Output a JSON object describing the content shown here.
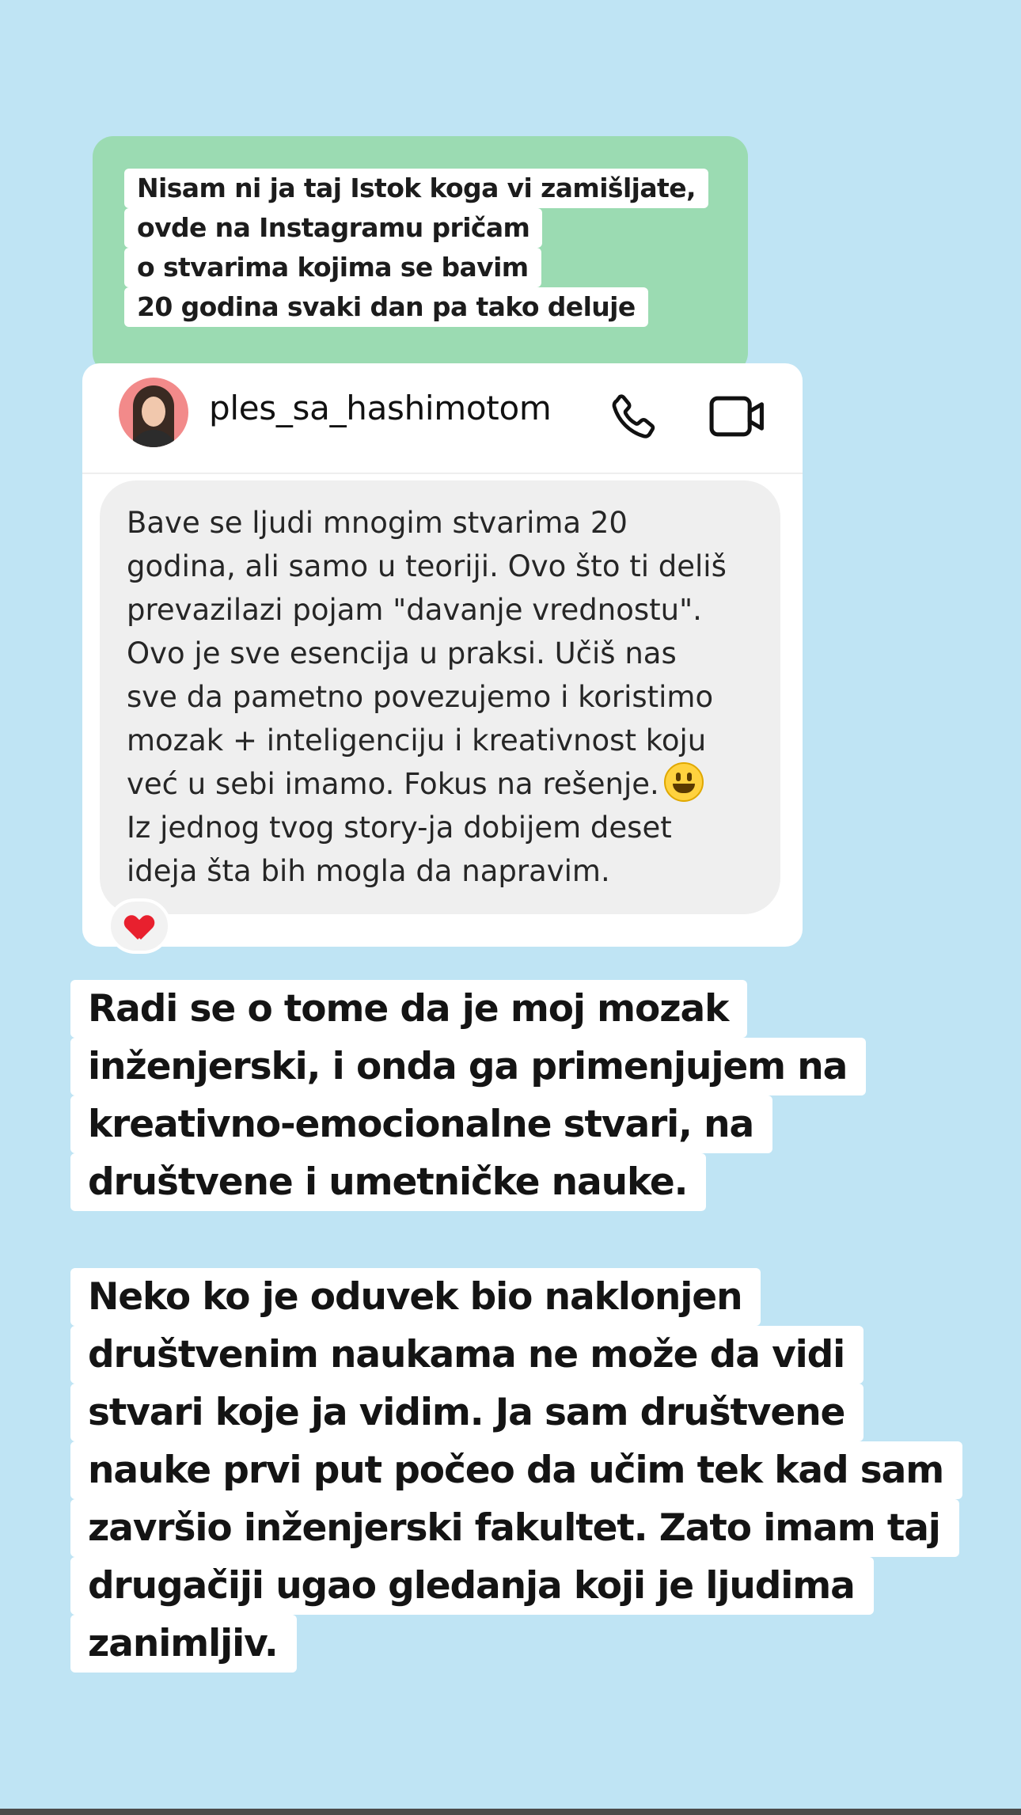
{
  "top_caption": {
    "lines": [
      "Nisam ni ja taj Istok koga vi zamišljate,",
      "ovde na Instagramu pričam",
      "o stvarima kojima se bavim",
      "20 godina svaki dan pa tako deluje"
    ]
  },
  "dm": {
    "username": "ples_sa_hashimotom",
    "icons": {
      "avatar": "profile-avatar",
      "call": "phone-icon",
      "video": "video-camera-icon"
    },
    "message": {
      "text_before_emoji": "Bave se ljudi mnogim stvarima 20\ngodina, ali samo u teoriji. Ovo što ti deliš\nprevazilazi pojam \"davanje vrednostu\".\nOvo je sve esencija u praksi. Učiš nas\nsve da pametno povezujemo i koristimo\nmozak + inteligenciju i kreativnost koju\nveć u sebi imamo. Fokus na rešenje.",
      "emoji": "smiley-emoji",
      "text_after_emoji": "Iz jednog tvog story-ja dobijem deset\nideja šta bih mogla da napravim."
    },
    "reaction": "heart-emoji"
  },
  "caption_1": {
    "lines": [
      "Radi se o tome da je moj mozak",
      "inženjerski, i onda ga primenjujem na",
      "kreativno-emocionalne stvari, na",
      "društvene i umetničke nauke."
    ]
  },
  "caption_2": {
    "lines": [
      "Neko ko je oduvek bio naklonjen",
      "društvenim naukama ne može da vidi",
      "stvari koje ja vidim. Ja sam društvene",
      "nauke prvi put počeo da učim tek kad sam",
      "završio inženjerski fakultet. Zato imam taj",
      "drugačiji ugao gledanja koji je ljudima",
      "zanimljiv."
    ]
  },
  "colors": {
    "background": "#bfe4f4",
    "top_card": "#9bdbb2",
    "bubble": "#efefef",
    "text_box": "#ffffff"
  }
}
